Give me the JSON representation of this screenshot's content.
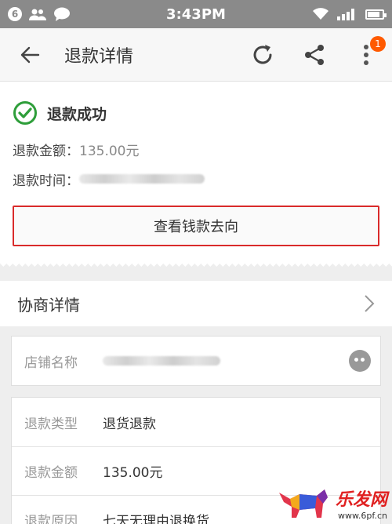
{
  "statusbar": {
    "notif_count": "6",
    "time": "3:43PM"
  },
  "toolbar": {
    "title": "退款详情",
    "badge": "1"
  },
  "status": {
    "title": "退款成功",
    "amount_label": "退款金额：",
    "amount_value": "135.00元",
    "time_label": "退款时间：",
    "button_label": "查看钱款去向"
  },
  "negotiation": {
    "title": "协商详情"
  },
  "shop": {
    "label": "店铺名称"
  },
  "details": [
    {
      "label": "退款类型",
      "value": "退货退款"
    },
    {
      "label": "退款金额",
      "value": "135.00元"
    },
    {
      "label": "退款原因",
      "value": "七天无理由退换货"
    }
  ],
  "watermark": {
    "brand": "乐发网",
    "url": "www.6pf.cn"
  },
  "colors": {
    "accent_red": "#d92b2b",
    "success_green": "#2e9e3a",
    "badge_orange": "#ff5a00"
  }
}
